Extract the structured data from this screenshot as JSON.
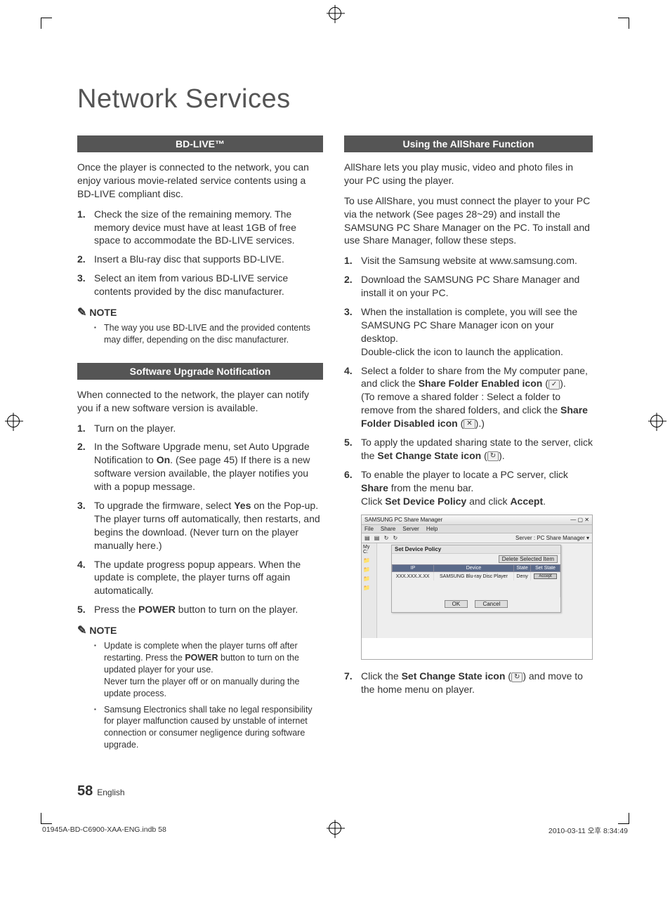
{
  "page": {
    "title": "Network Services",
    "page_number": "58",
    "language": "English"
  },
  "print": {
    "file": "01945A-BD-C6900-XAA-ENG.indb   58",
    "timestamp": "2010-03-11   오후 8:34:49"
  },
  "left": {
    "bdlive": {
      "heading": "BD-LIVE™",
      "intro": "Once the player is connected to the network, you can enjoy various movie-related service contents using a BD-LIVE compliant disc.",
      "steps": {
        "s1": "Check the size of the remaining memory. The memory device must have at least 1GB of free space to accommodate the BD-LIVE services.",
        "s2": "Insert a Blu-ray disc that supports BD-LIVE.",
        "s3": "Select an item from various BD-LIVE service contents provided by the disc manufacturer."
      },
      "note_label": "NOTE",
      "notes": {
        "n1": "The way you use BD-LIVE and the provided contents may differ, depending on the disc manufacturer."
      }
    },
    "upgrade": {
      "heading": "Software Upgrade Notification",
      "intro": "When connected to the network, the player can notify you if a new software version is available.",
      "steps": {
        "s1": "Turn on the player.",
        "s2_pre": "In the Software Upgrade menu, set Auto Upgrade Notification to ",
        "s2_on": "On",
        "s2_post": ". (See page 45) If there is a new software version available, the player notifies you with a popup message.",
        "s3_pre": "To upgrade the firmware, select ",
        "s3_yes": "Yes",
        "s3_post": " on the Pop-up. The player turns off automatically, then restarts, and begins the download. (Never turn on the player manually here.)",
        "s4": "The update progress popup appears. When the update is complete, the player turns off again automatically.",
        "s5_pre": "Press the ",
        "s5_power": "POWER",
        "s5_post": " button to turn on the player."
      },
      "note_label": "NOTE",
      "notes": {
        "n1_pre": "Update is complete when the player turns off after restarting. Press the ",
        "n1_power": "POWER",
        "n1_post": " button to turn on the updated player for your use.\nNever turn the player off or on manually during the update process.",
        "n2": "Samsung Electronics shall take no legal responsibility for player malfunction caused by unstable of internet connection or consumer negligence during software upgrade."
      }
    }
  },
  "right": {
    "allshare": {
      "heading": "Using the AllShare Function",
      "intro1": "AllShare lets you play music, video and photo files in your PC using the player.",
      "intro2": "To use AllShare, you must connect the player to your PC via the network (See pages 28~29) and install the SAMSUNG PC Share Manager on the PC. To install and use Share Manager, follow these steps.",
      "steps": {
        "s1": "Visit the Samsung website at www.samsung.com.",
        "s2": "Download the SAMSUNG PC Share Manager and install it on your PC.",
        "s3": "When the installation is complete, you will see the SAMSUNG PC Share Manager icon on your desktop.\nDouble-click the icon to launch the application.",
        "s4_pre": "Select a folder to share from the My computer pane, and click the ",
        "s4_enabled": "Share Folder Enabled icon",
        "s4_mid": " (",
        "s4_icon": "✓",
        "s4_mid2": ").\n(To remove a shared folder : Select a folder to remove from the shared folders, and click the ",
        "s4_disabled": "Share Folder Disabled icon",
        "s4_mid3": " (",
        "s4_icon2": "✕",
        "s4_post": ").)",
        "s5_pre": "To apply the updated sharing state to the server, click the ",
        "s5_set": "Set Change State icon",
        "s5_mid": " (",
        "s5_icon": "↻",
        "s5_post": ").",
        "s6_pre": "To enable the player to locate a PC server, click ",
        "s6_share": "Share",
        "s6_mid": " from the menu bar.\nClick ",
        "s6_policy": "Set Device Policy",
        "s6_mid2": " and click ",
        "s6_accept": "Accept",
        "s6_post": ".",
        "s7_pre": "Click the ",
        "s7_set": "Set Change State icon",
        "s7_mid": " (",
        "s7_icon": "↻",
        "s7_post": ") and move to the home menu on player."
      }
    }
  },
  "app": {
    "title": "SAMSUNG PC Share Manager",
    "menu": {
      "file": "File",
      "share": "Share",
      "server": "Server",
      "help": "Help"
    },
    "toolbar_right": "Server : PC Share Manager  ▾",
    "side_label": "My C:",
    "dialog": {
      "title": "Set Device Policy",
      "delete": "Delete Selected Item",
      "th_ip": "IP",
      "th_device": "Device",
      "th_state": "State",
      "th_setstate": "Set State",
      "row_ip": "XXX.XXX.X.XX",
      "row_device": "SAMSUNG Blu-ray Disc Player",
      "row_state": "Deny",
      "row_accept": "Accept",
      "ok": "OK",
      "cancel": "Cancel"
    }
  }
}
